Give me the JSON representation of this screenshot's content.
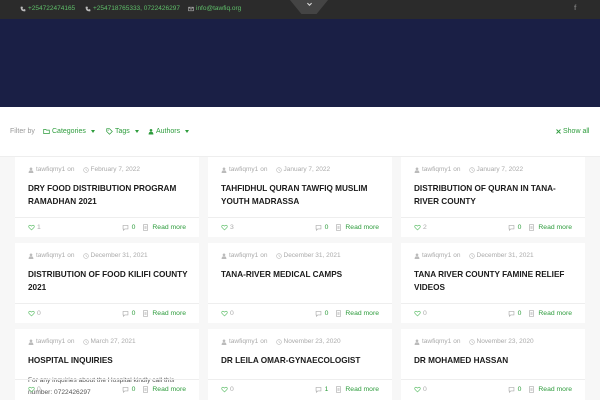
{
  "topbar": {
    "phone1": "+254722474165",
    "phone2": "+254718765333, 0722426297",
    "email": "info@tawfiq.org",
    "social": "f"
  },
  "filter": {
    "label": "Filter by",
    "categories": "Categories",
    "tags": "Tags",
    "authors": "Authors",
    "show_all": "Show all"
  },
  "post_meta": {
    "on": "on"
  },
  "read_more": "Read more",
  "posts": [
    {
      "author": "tawfiqmy1",
      "date": "February 7, 2022",
      "title": "DRY FOOD DISTRIBUTION PROGRAM RAMADHAN 2021",
      "excerpt": "",
      "likes": "1",
      "comments": "0"
    },
    {
      "author": "tawfiqmy1",
      "date": "January 7, 2022",
      "title": "TAHFIDHUL QURAN TAWFIQ MUSLIM YOUTH MADRASSA",
      "excerpt": "",
      "likes": "3",
      "comments": "0"
    },
    {
      "author": "tawfiqmy1",
      "date": "January 7, 2022",
      "title": "DISTRIBUTION OF QURAN IN TANA-RIVER COUNTY",
      "excerpt": "",
      "likes": "2",
      "comments": "0"
    },
    {
      "author": "tawfiqmy1",
      "date": "December 31, 2021",
      "title": "DISTRIBUTION OF FOOD KILIFI COUNTY 2021",
      "excerpt": "",
      "likes": "0",
      "comments": "0"
    },
    {
      "author": "tawfiqmy1",
      "date": "December 31, 2021",
      "title": "TANA-RIVER MEDICAL CAMPS",
      "excerpt": "",
      "likes": "0",
      "comments": "0"
    },
    {
      "author": "tawfiqmy1",
      "date": "December 31, 2021",
      "title": "TANA RIVER COUNTY FAMINE RELIEF VIDEOS",
      "excerpt": "",
      "likes": "0",
      "comments": "0"
    },
    {
      "author": "tawfiqmy1",
      "date": "March 27, 2021",
      "title": "HOSPITAL INQUIRIES",
      "excerpt": "For any inquiries about the Hospital kindly call this number: 0722426297",
      "likes": "0",
      "comments": "0"
    },
    {
      "author": "tawfiqmy1",
      "date": "November 23, 2020",
      "title": "DR LEILA OMAR-GYNAECOLOGIST",
      "excerpt": "",
      "likes": "0",
      "comments": "1"
    },
    {
      "author": "tawfiqmy1",
      "date": "November 23, 2020",
      "title": "DR MOHAMED HASSAN",
      "excerpt": "",
      "likes": "0",
      "comments": "0"
    }
  ]
}
